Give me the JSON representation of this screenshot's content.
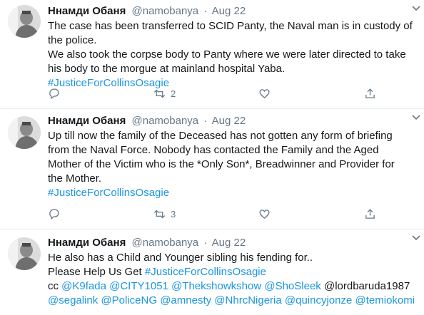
{
  "tweets": [
    {
      "name": "Ннамди Обаня",
      "handle": "@namobanya",
      "date": "Aug 22",
      "lines": [
        "The case has been transferred to SCID Panty, the Naval man is in custody of",
        "the police.",
        "We also took the corpse body to Panty where we were later directed to take",
        "his body to the morgue at mainland hospital Yaba."
      ],
      "hashtag": "#JusticeForCollinsOsagie",
      "retweets": "2"
    },
    {
      "name": "Ннамди Обаня",
      "handle": "@namobanya",
      "date": "Aug 22",
      "lines": [
        "Up till now the family of the Deceased has not gotten any form of briefing",
        "from the Naval Force. Nobody has contacted the Family and the Aged",
        "Mother of the Victim who is the *Only Son*, Breadwinner and Provider for",
        "the Mother."
      ],
      "hashtag": "#JusticeForCollinsOsagie",
      "retweets": "3"
    },
    {
      "name": "Ннамди Обаня",
      "handle": "@namobanya",
      "date": "Aug 22",
      "line1": "He also has a Child and Younger sibling his fending for..",
      "line2_prefix": "Please Help Us Get",
      "hashtag": "#JusticeForCollinsOsagie",
      "cc": "cc",
      "mentions_row1": [
        "@K9fada",
        "@CITY1051",
        "@Thekshowkshow",
        "@ShoSleek"
      ],
      "plain_mention": "@lordbaruda1987",
      "mentions_row2": [
        "@segalink",
        "@PoliceNG",
        "@amnesty",
        "@NhrcNigeria",
        "@quincyjonze",
        "@temiokomi"
      ]
    }
  ],
  "icons": {
    "reply": "reply-icon",
    "retweet": "retweet-icon",
    "like": "heart-icon",
    "share": "share-icon",
    "more": "chevron-down-icon"
  },
  "colors": {
    "link": "#1b95e0",
    "muted": "#657786",
    "divider": "#e6ecf0"
  }
}
